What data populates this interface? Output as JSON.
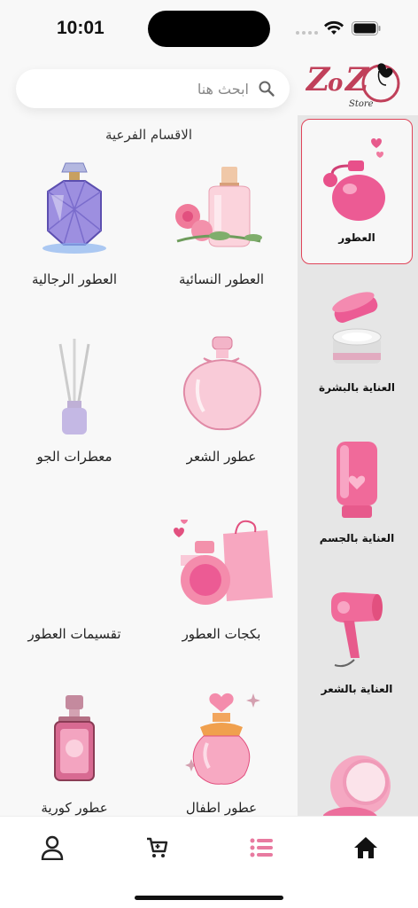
{
  "status_bar": {
    "time": "10:01"
  },
  "brand": {
    "logo_text": "ZoZo",
    "logo_subtitle": "Store",
    "accent": "#e0455a",
    "logo_color": "#c0405a"
  },
  "search": {
    "placeholder": "ابحث هنا",
    "value": ""
  },
  "section_title": "الاقسام الفرعية",
  "sidebar": {
    "items": [
      {
        "label": "العطور",
        "icon": "perfume-icon",
        "active": true
      },
      {
        "label": "العناية بالبشرة",
        "icon": "cream-jar-icon",
        "active": false
      },
      {
        "label": "العناية بالجسم",
        "icon": "lotion-tube-icon",
        "active": false
      },
      {
        "label": "العناية بالشعر",
        "icon": "hair-dryer-icon",
        "active": false
      },
      {
        "label": "",
        "icon": "compact-powder-icon",
        "active": false
      }
    ]
  },
  "subcategories": [
    {
      "label": "العطور النسائية",
      "icon": "womens-perfume-icon"
    },
    {
      "label": "العطور الرجالية",
      "icon": "mens-perfume-icon"
    },
    {
      "label": "عطور الشعر",
      "icon": "hair-perfume-icon"
    },
    {
      "label": "معطرات الجو",
      "icon": "reed-diffuser-icon"
    },
    {
      "label": "بكجات العطور",
      "icon": "gift-bag-icon"
    },
    {
      "label": "تقسيمات العطور",
      "icon": ""
    },
    {
      "label": "عطور اطفال",
      "icon": "kids-perfume-icon"
    },
    {
      "label": "عطور كورية",
      "icon": "korean-perfume-icon"
    }
  ],
  "bottom_nav": [
    {
      "name": "account",
      "icon": "user-icon",
      "active": false
    },
    {
      "name": "cart",
      "icon": "cart-icon",
      "active": false
    },
    {
      "name": "categories",
      "icon": "list-icon",
      "active": true
    },
    {
      "name": "home",
      "icon": "home-icon",
      "active": false
    }
  ]
}
